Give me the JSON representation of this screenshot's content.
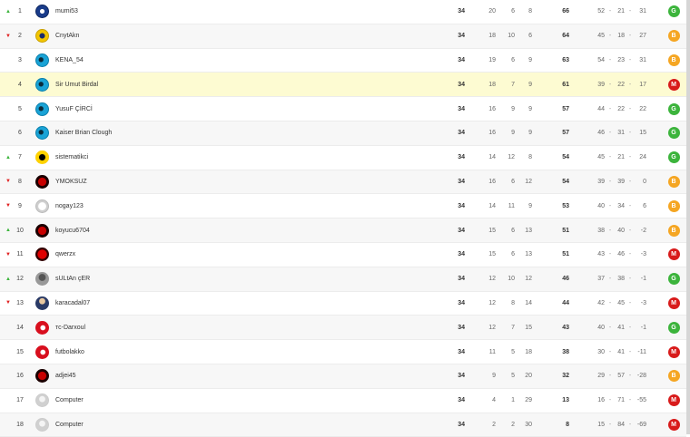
{
  "colors": {
    "win": "#3cb43c",
    "draw": "#f5a623",
    "loss": "#d81b1b",
    "highlight": "#fdfbd2"
  },
  "rows": [
    {
      "trend": "up",
      "rank": "1",
      "name": "mumi53",
      "avatar": "blue-logo-avatar",
      "played": "34",
      "won": "20",
      "drawn": "6",
      "lost": "8",
      "points": "66",
      "gf": "52",
      "ga": "21",
      "gd": "31",
      "form": "G"
    },
    {
      "trend": "down",
      "rank": "2",
      "name": "CnytAkn",
      "avatar": "yellow-logo-avatar",
      "played": "34",
      "won": "18",
      "drawn": "10",
      "lost": "6",
      "points": "64",
      "gf": "45",
      "ga": "18",
      "gd": "27",
      "form": "B"
    },
    {
      "trend": "none",
      "rank": "3",
      "name": "KENA_54",
      "avatar": "cyan-shark-avatar",
      "played": "34",
      "won": "19",
      "drawn": "6",
      "lost": "9",
      "points": "63",
      "gf": "54",
      "ga": "23",
      "gd": "31",
      "form": "B"
    },
    {
      "trend": "none",
      "rank": "4",
      "name": "Sir Umut Birdal",
      "avatar": "cyan-shark-avatar",
      "played": "34",
      "won": "18",
      "drawn": "7",
      "lost": "9",
      "points": "61",
      "gf": "39",
      "ga": "22",
      "gd": "17",
      "form": "M",
      "highlight": true
    },
    {
      "trend": "none",
      "rank": "5",
      "name": "YusuF ÇİRCİ",
      "avatar": "cyan-shark-avatar",
      "played": "34",
      "won": "16",
      "drawn": "9",
      "lost": "9",
      "points": "57",
      "gf": "44",
      "ga": "22",
      "gd": "22",
      "form": "G"
    },
    {
      "trend": "none",
      "rank": "6",
      "name": "Kaiser Brian Clough",
      "avatar": "cyan-shark-avatar",
      "played": "34",
      "won": "16",
      "drawn": "9",
      "lost": "9",
      "points": "57",
      "gf": "46",
      "ga": "31",
      "gd": "15",
      "form": "G"
    },
    {
      "trend": "up",
      "rank": "7",
      "name": "sistematikci",
      "avatar": "yellow-black-avatar",
      "played": "34",
      "won": "14",
      "drawn": "12",
      "lost": "8",
      "points": "54",
      "gf": "45",
      "ga": "21",
      "gd": "24",
      "form": "G"
    },
    {
      "trend": "down",
      "rank": "8",
      "name": "YMOKSUZ",
      "avatar": "red-bull-avatar",
      "played": "34",
      "won": "16",
      "drawn": "6",
      "lost": "12",
      "points": "54",
      "gf": "39",
      "ga": "39",
      "gd": "0",
      "form": "B"
    },
    {
      "trend": "down",
      "rank": "9",
      "name": "nogay123",
      "avatar": "white-bull-avatar",
      "played": "34",
      "won": "14",
      "drawn": "11",
      "lost": "9",
      "points": "53",
      "gf": "40",
      "ga": "34",
      "gd": "6",
      "form": "B"
    },
    {
      "trend": "up",
      "rank": "10",
      "name": "koyucu6704",
      "avatar": "red-bull-avatar",
      "played": "34",
      "won": "15",
      "drawn": "6",
      "lost": "13",
      "points": "51",
      "gf": "38",
      "ga": "40",
      "gd": "-2",
      "form": "B"
    },
    {
      "trend": "down",
      "rank": "11",
      "name": "qwerzx",
      "avatar": "red-devil-avatar",
      "played": "34",
      "won": "15",
      "drawn": "6",
      "lost": "13",
      "points": "51",
      "gf": "43",
      "ga": "46",
      "gd": "-3",
      "form": "M"
    },
    {
      "trend": "up",
      "rank": "12",
      "name": "sULtAn çER",
      "avatar": "grey-photo-avatar",
      "played": "34",
      "won": "12",
      "drawn": "10",
      "lost": "12",
      "points": "46",
      "gf": "37",
      "ga": "38",
      "gd": "-1",
      "form": "G"
    },
    {
      "trend": "down",
      "rank": "13",
      "name": "karacadal07",
      "avatar": "person-photo-avatar",
      "played": "34",
      "won": "12",
      "drawn": "8",
      "lost": "14",
      "points": "44",
      "gf": "42",
      "ga": "45",
      "gd": "-3",
      "form": "M"
    },
    {
      "trend": "none",
      "rank": "14",
      "name": "тс-Darxoul",
      "avatar": "turkish-flag-avatar",
      "played": "34",
      "won": "12",
      "drawn": "7",
      "lost": "15",
      "points": "43",
      "gf": "40",
      "ga": "41",
      "gd": "-1",
      "form": "G"
    },
    {
      "trend": "none",
      "rank": "15",
      "name": "futbolakko",
      "avatar": "turkish-flag-avatar",
      "played": "34",
      "won": "11",
      "drawn": "5",
      "lost": "18",
      "points": "38",
      "gf": "30",
      "ga": "41",
      "gd": "-11",
      "form": "M"
    },
    {
      "trend": "none",
      "rank": "16",
      "name": "adjei45",
      "avatar": "red-bull-avatar",
      "played": "34",
      "won": "9",
      "drawn": "5",
      "lost": "20",
      "points": "32",
      "gf": "29",
      "ga": "57",
      "gd": "-28",
      "form": "B"
    },
    {
      "trend": "none",
      "rank": "17",
      "name": "Computer",
      "avatar": "computer-avatar",
      "played": "34",
      "won": "4",
      "drawn": "1",
      "lost": "29",
      "points": "13",
      "gf": "16",
      "ga": "71",
      "gd": "-55",
      "form": "M"
    },
    {
      "trend": "none",
      "rank": "18",
      "name": "Computer",
      "avatar": "computer-avatar",
      "played": "34",
      "won": "2",
      "drawn": "2",
      "lost": "30",
      "points": "8",
      "gf": "15",
      "ga": "84",
      "gd": "-69",
      "form": "M"
    }
  ]
}
